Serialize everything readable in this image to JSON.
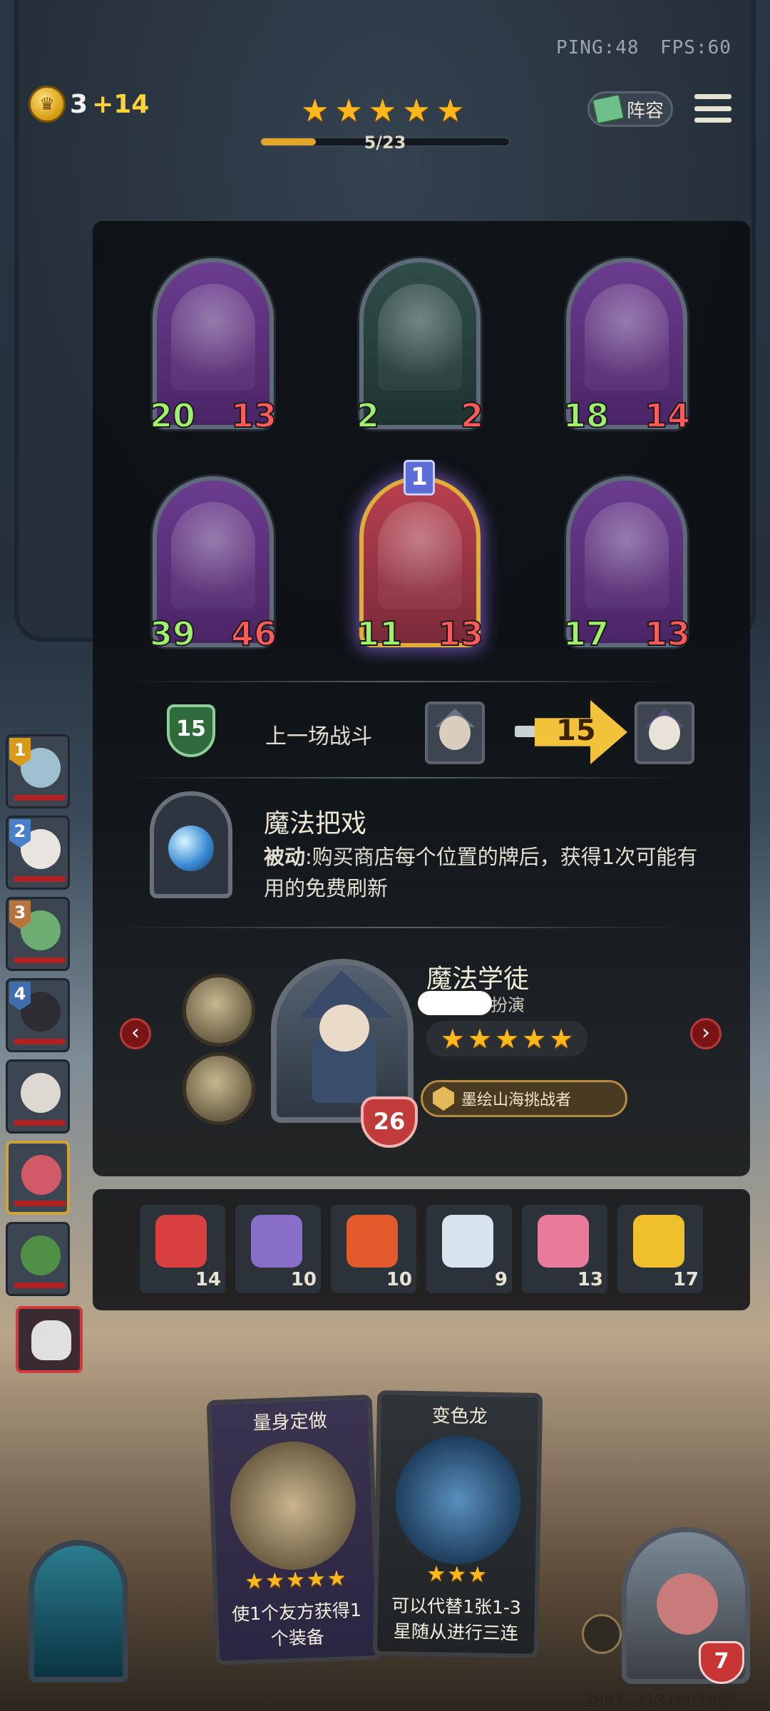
{
  "hud": {
    "ping_text": "PING:48",
    "fps_text": "FPS:60",
    "gold": "3",
    "gold_income": "+14",
    "stars_count": 5,
    "progress_text": "5/23",
    "progress_fraction": 0.22,
    "lineup_label": "阵容"
  },
  "shop_cards": [
    {
      "attack": "20",
      "health": "13",
      "theme": "purple"
    },
    {
      "attack": "2",
      "health": "2",
      "theme": "green"
    },
    {
      "attack": "18",
      "health": "14",
      "theme": "purple"
    },
    {
      "attack": "39",
      "health": "46",
      "theme": "purple"
    },
    {
      "attack": "11",
      "health": "13",
      "theme": "gold",
      "tier": "1"
    },
    {
      "attack": "17",
      "health": "13",
      "theme": "purple"
    }
  ],
  "last_battle": {
    "level": "15",
    "label": "上一场战斗",
    "damage": "15"
  },
  "skill": {
    "title": "魔法把戏",
    "type_label": "被动",
    "description": ":购买商店每个位置的牌后，获得1次可能有用的免费刷新"
  },
  "hero": {
    "name": "魔法学徒",
    "subtitle": "扮演",
    "health": "26",
    "stars": 5,
    "title_badge": "墨绘山海挑战者"
  },
  "items": [
    {
      "icon": "clown-icon",
      "count": "14",
      "color": "#d84040"
    },
    {
      "icon": "striped-shield-icon",
      "count": "10",
      "color": "#8a6fc9"
    },
    {
      "icon": "alarm-clock-icon",
      "count": "10",
      "color": "#e25a2c"
    },
    {
      "icon": "teacup-icon",
      "count": "9",
      "color": "#d7e3ef"
    },
    {
      "icon": "cupcake-icon",
      "count": "13",
      "color": "#e87a9a"
    },
    {
      "icon": "rubber-chicken-icon",
      "count": "17",
      "color": "#f0c02c"
    }
  ],
  "roster": [
    {
      "rank": "1",
      "rank_color": "#d99a17"
    },
    {
      "rank": "2",
      "rank_color": "#4a7fc9"
    },
    {
      "rank": "3",
      "rank_color": "#b9743c"
    },
    {
      "rank": "4",
      "rank_color": "#3f6db0"
    },
    {
      "rank": "",
      "rank_color": ""
    },
    {
      "rank": "",
      "rank_color": ""
    },
    {
      "rank": "",
      "rank_color": ""
    }
  ],
  "bottom_cards": [
    {
      "name": "量身定做",
      "stars": 5,
      "description": "使1个友方获得1个装备"
    },
    {
      "name": "变色龙",
      "stars": 3,
      "description": "可以代替1张1-3星随从进行三连"
    }
  ],
  "player": {
    "life": "7",
    "build_code": "2801.2131691006"
  }
}
